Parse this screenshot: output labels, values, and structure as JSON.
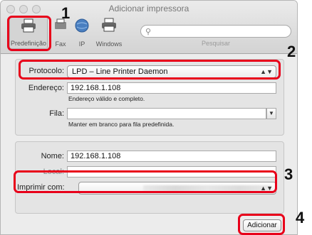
{
  "window": {
    "title": "Adicionar impressora"
  },
  "toolbar": {
    "tools": [
      "Predefinição",
      "Fax",
      "IP",
      "Windows"
    ],
    "search_label": "Pesquisar",
    "search_placeholder": ""
  },
  "protocol": {
    "label": "Protocolo:",
    "value": "LPD – Line Printer Daemon"
  },
  "address": {
    "label": "Endereço:",
    "value": "192.168.1.108",
    "hint": "Endereço válido e completo."
  },
  "queue": {
    "label": "Fila:",
    "value": "",
    "hint": "Manter em branco para fila predefinida."
  },
  "name": {
    "label": "Nome:",
    "value": "192.168.1.108"
  },
  "location": {
    "label": "Local:",
    "value": ""
  },
  "use": {
    "label": "Imprimir com:",
    "value": ""
  },
  "buttons": {
    "add": "Adicionar"
  },
  "callouts": [
    "1",
    "2",
    "3",
    "4"
  ],
  "colors": {
    "highlight": "#e8001a"
  }
}
